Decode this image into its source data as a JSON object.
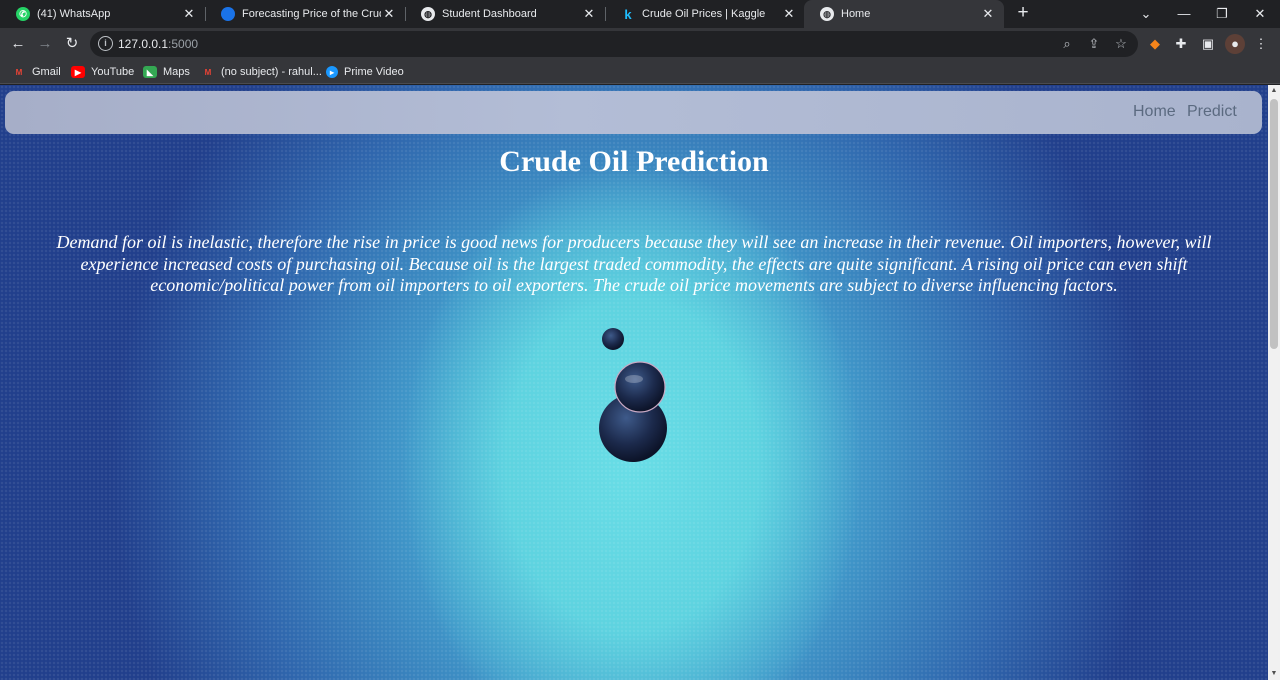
{
  "browser": {
    "tabs": [
      {
        "title": "(41) WhatsApp",
        "icon": "whatsapp-icon",
        "color": "#25d366"
      },
      {
        "title": "Forecasting Price of the Crude oi",
        "icon": "site-icon",
        "color": "#1a73e8"
      },
      {
        "title": "Student Dashboard",
        "icon": "globe-icon",
        "color": "#e8eaed"
      },
      {
        "title": "Crude Oil Prices | Kaggle",
        "icon": "kaggle-icon",
        "color": "#20beff"
      },
      {
        "title": "Home",
        "icon": "globe-icon",
        "color": "#e8eaed"
      }
    ],
    "url_host": "127.0.0.1",
    "url_port": ":5000",
    "bookmarks": [
      {
        "label": "Gmail",
        "icon": "gmail-icon",
        "color": "#ea4335"
      },
      {
        "label": "YouTube",
        "icon": "youtube-icon",
        "color": "#ff0000"
      },
      {
        "label": "Maps",
        "icon": "maps-icon",
        "color": "#34a853"
      },
      {
        "label": "(no subject) - rahul...",
        "icon": "gmail-icon",
        "color": "#ea4335"
      },
      {
        "label": "Prime Video",
        "icon": "prime-video-icon",
        "color": "#1a98ff"
      }
    ]
  },
  "nav": {
    "home": "Home",
    "predict": "Predict"
  },
  "page": {
    "title": "Crude Oil Prediction",
    "description": "Demand for oil is inelastic, therefore the rise in price is good news for producers because they will see an increase in their revenue. Oil importers, however, will experience increased costs of purchasing oil. Because oil is the largest traded commodity, the effects are quite significant. A rising oil price can even shift economic/political power from oil importers to oil exporters. The crude oil price movements are subject to diverse influencing factors."
  },
  "colors": {
    "background_center": "#68dde6",
    "background_edge": "#213f8c",
    "navbar": "#b3bdd6",
    "nav_link": "#5b6a80",
    "text": "#ffffff"
  }
}
